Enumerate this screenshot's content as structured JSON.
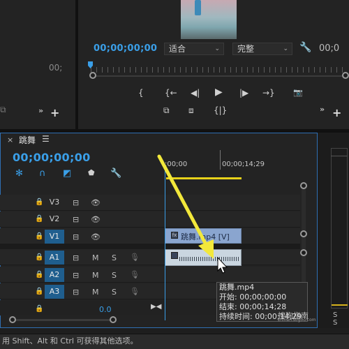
{
  "source_panel": {
    "timecode": "00;"
  },
  "program_monitor": {
    "timecode": "00;00;00;00",
    "fit_select": "适合",
    "quality_select": "完整",
    "timecode_right": "00;0",
    "controls_row1": [
      "{",
      "{←",
      "◀|",
      "▶",
      "|▶",
      "→}",
      "📷"
    ],
    "controls_row2": [
      "⧉",
      "⧈",
      "{|}"
    ]
  },
  "timeline": {
    "sequence_name": "跳舞",
    "timecode": "00;00;00;00",
    "ruler_start": ";00;00",
    "ruler_mark": "00;00;14;29",
    "tracks": [
      {
        "name": "V3",
        "active": false
      },
      {
        "name": "V2",
        "active": false
      },
      {
        "name": "V1",
        "active": true
      },
      {
        "name": "A1",
        "active": true,
        "audio": true
      },
      {
        "name": "A2",
        "active": true,
        "audio": true
      },
      {
        "name": "A3",
        "active": true,
        "audio": true
      }
    ],
    "mute_label": "M",
    "solo_label": "S",
    "clip_video_label": "跳舞.mp4 [V]",
    "mix_value": "0.0"
  },
  "tooltip": {
    "filename": "跳舞.mp4",
    "start": "开始: 00;00;00;00",
    "end": "结束: 00;00;14;28",
    "duration": "持续时间: 00;00;14;29"
  },
  "meter": {
    "labels": "S S"
  },
  "status_bar": {
    "text": "用 Shift、Alt 和 Ctrl 可获得其他选项。"
  },
  "watermark": {
    "text": "搜狗指南",
    "sub": "zhinan.sogou.com"
  },
  "colors": {
    "accent": "#3a9fe8",
    "track_active": "#1f5e8e",
    "arrow": "#f2e83b",
    "work_area": "#e8d21a"
  }
}
